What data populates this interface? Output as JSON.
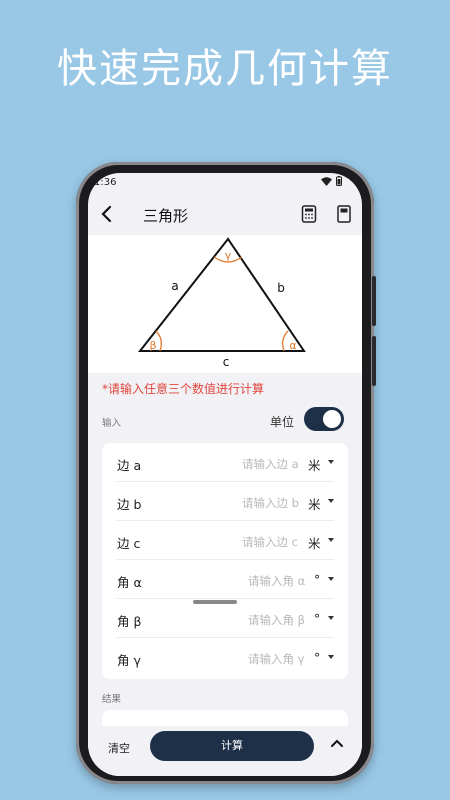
{
  "headline": "快速完成几何计算",
  "status": {
    "time": "1:36"
  },
  "appbar": {
    "title": "三角形",
    "back_icon": "chevron-left-icon",
    "calculator_icon": "calculator-icon",
    "book_icon": "book-icon"
  },
  "diagram": {
    "side_a": "a",
    "side_b": "b",
    "side_c": "c",
    "angle_alpha": "α",
    "angle_beta": "β",
    "angle_gamma": "γ",
    "angle_color": "#e07a2e"
  },
  "hint": "*请输入任意三个数值进行计算",
  "input_section": {
    "label": "输入",
    "unit_label": "单位",
    "unit_toggle_on": true
  },
  "rows": [
    {
      "name": "边 a",
      "placeholder": "请输入边 a",
      "unit": "米"
    },
    {
      "name": "边 b",
      "placeholder": "请输入边 b",
      "unit": "米"
    },
    {
      "name": "边 c",
      "placeholder": "请输入边 c",
      "unit": "米"
    },
    {
      "name": "角 α",
      "placeholder": "请输入角 α",
      "unit": "°"
    },
    {
      "name": "角 β",
      "placeholder": "请输入角 β",
      "unit": "°"
    },
    {
      "name": "角 γ",
      "placeholder": "请输入角 γ",
      "unit": "°"
    }
  ],
  "result_section": {
    "label": "结果"
  },
  "bottombar": {
    "clear_label": "清空",
    "calc_label": "计算"
  },
  "colors": {
    "background": "#98c8e6",
    "accent": "#1e3048",
    "hint": "#e0463c"
  }
}
